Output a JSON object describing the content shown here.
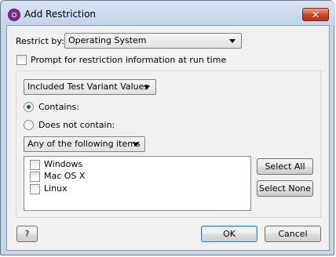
{
  "window": {
    "title": "Add Restriction",
    "close_label": "✕"
  },
  "restrict_by": {
    "label": "Restrict by:",
    "value": "Operating System"
  },
  "prompt_checkbox": {
    "label": "Prompt for restriction information at run time",
    "checked": false
  },
  "variant_select": {
    "value": "Included Test Variant Values"
  },
  "contains_radio": {
    "label": "Contains:",
    "checked": true
  },
  "not_contains_radio": {
    "label": "Does not contain:",
    "checked": false
  },
  "match_select": {
    "value": "Any of the following items"
  },
  "items": [
    {
      "label": "Windows",
      "checked": false
    },
    {
      "label": "Mac OS X",
      "checked": false
    },
    {
      "label": "Linux",
      "checked": false
    }
  ],
  "buttons": {
    "select_all": "Select All",
    "select_none": "Select None",
    "help": "?",
    "ok": "OK",
    "cancel": "Cancel"
  }
}
